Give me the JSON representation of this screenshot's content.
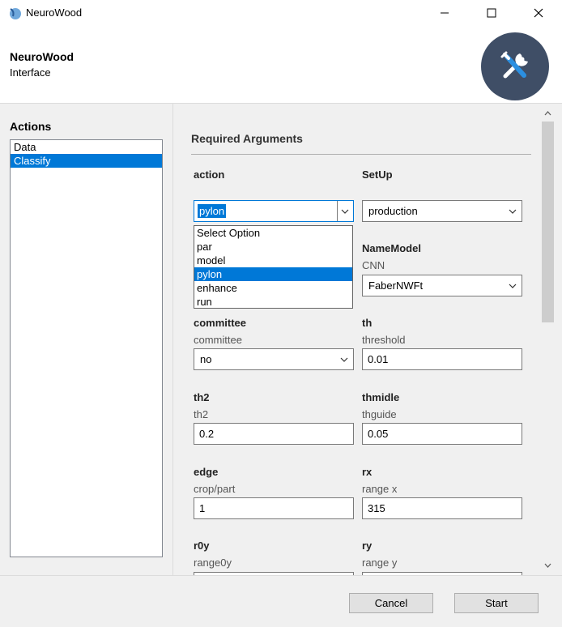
{
  "window": {
    "title": "NeuroWood",
    "accent": "#0078d7"
  },
  "header": {
    "title": "NeuroWood",
    "subtitle": "Interface",
    "logo_icon": "tools-icon",
    "logo_bg": "#3f4e66"
  },
  "actions": {
    "title": "Actions",
    "items": [
      {
        "label": "Data",
        "selected": false
      },
      {
        "label": "Classify",
        "selected": true
      }
    ]
  },
  "form": {
    "section_title": "Required Arguments",
    "action": {
      "label": "action",
      "value": "pylon"
    },
    "action_options": [
      "Select Option",
      "par",
      "model",
      "pylon",
      "enhance",
      "run"
    ],
    "setup": {
      "label": "SetUp",
      "value": "production"
    },
    "namemodel": {
      "label": "NameModel",
      "sub": "CNN",
      "value": "FaberNWFt"
    },
    "committee": {
      "label": "committee",
      "sub": "committee",
      "value": "no"
    },
    "th": {
      "label": "th",
      "sub": "threshold",
      "value": "0.01"
    },
    "th2": {
      "label": "th2",
      "sub": "th2",
      "value": "0.2"
    },
    "thmidle": {
      "label": "thmidle",
      "sub": "thguide",
      "value": "0.05"
    },
    "edge": {
      "label": "edge",
      "sub": "crop/part",
      "value": "1"
    },
    "rx": {
      "label": "rx",
      "sub": "range x",
      "value": "315"
    },
    "r0y": {
      "label": "r0y",
      "sub": "range0y"
    },
    "ry": {
      "label": "ry",
      "sub": "range y"
    }
  },
  "footer": {
    "cancel_label": "Cancel",
    "start_label": "Start"
  }
}
